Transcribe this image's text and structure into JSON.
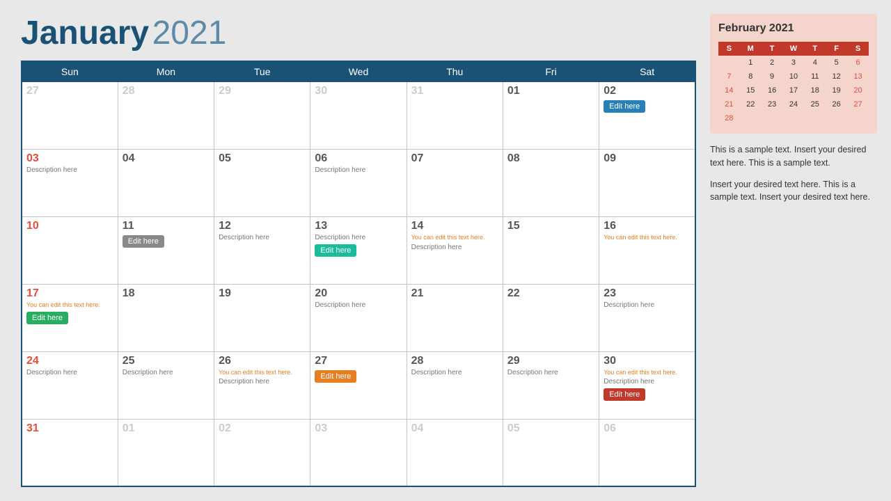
{
  "header": {
    "month": "January",
    "year": "2021"
  },
  "calendar": {
    "days": [
      "Sun",
      "Mon",
      "Tue",
      "Wed",
      "Thu",
      "Fri",
      "Sat"
    ],
    "rows": [
      [
        {
          "num": "27",
          "type": "other-month"
        },
        {
          "num": "28",
          "type": "other-month"
        },
        {
          "num": "29",
          "type": "other-month"
        },
        {
          "num": "30",
          "type": "other-month"
        },
        {
          "num": "31",
          "type": "other-month"
        },
        {
          "num": "01",
          "type": "normal"
        },
        {
          "num": "02",
          "type": "normal",
          "event": {
            "label": "Edit here",
            "color": "btn-teal"
          }
        }
      ],
      [
        {
          "num": "03",
          "type": "sunday",
          "desc": "Description here"
        },
        {
          "num": "04",
          "type": "normal"
        },
        {
          "num": "05",
          "type": "normal"
        },
        {
          "num": "06",
          "type": "normal",
          "desc": "Description here"
        },
        {
          "num": "07",
          "type": "normal"
        },
        {
          "num": "08",
          "type": "normal"
        },
        {
          "num": "09",
          "type": "normal"
        }
      ],
      [
        {
          "num": "10",
          "type": "sunday"
        },
        {
          "num": "11",
          "type": "normal",
          "event": {
            "label": "Edit here",
            "color": "btn-gray"
          }
        },
        {
          "num": "12",
          "type": "normal",
          "desc": "Description here"
        },
        {
          "num": "13",
          "type": "normal",
          "desc": "Description here",
          "event": {
            "label": "Edit here",
            "color": "btn-cyan"
          }
        },
        {
          "num": "14",
          "type": "normal",
          "note": "You can edit this text here.",
          "desc": "Description here"
        },
        {
          "num": "15",
          "type": "normal"
        },
        {
          "num": "16",
          "type": "normal",
          "note": "You can edit this text here."
        }
      ],
      [
        {
          "num": "17",
          "type": "sunday",
          "note": "You can edit this text here.",
          "event": {
            "label": "Edit here",
            "color": "btn-green"
          }
        },
        {
          "num": "18",
          "type": "normal"
        },
        {
          "num": "19",
          "type": "normal"
        },
        {
          "num": "20",
          "type": "normal",
          "desc": "Description here"
        },
        {
          "num": "21",
          "type": "normal"
        },
        {
          "num": "22",
          "type": "normal"
        },
        {
          "num": "23",
          "type": "normal",
          "desc": "Description here"
        }
      ],
      [
        {
          "num": "24",
          "type": "sunday",
          "desc": "Description here"
        },
        {
          "num": "25",
          "type": "normal",
          "desc": "Description here"
        },
        {
          "num": "26",
          "type": "normal",
          "note": "You can edit this text here.",
          "desc": "Description here"
        },
        {
          "num": "27",
          "type": "normal",
          "event": {
            "label": "Edit here",
            "color": "btn-orange"
          }
        },
        {
          "num": "28",
          "type": "normal",
          "desc": "Description here"
        },
        {
          "num": "29",
          "type": "normal",
          "desc": "Description here"
        },
        {
          "num": "30",
          "type": "normal",
          "note": "You can edit this text here.",
          "desc": "Description here",
          "event": {
            "label": "Edit here",
            "color": "btn-red"
          }
        }
      ],
      [
        {
          "num": "31",
          "type": "sunday"
        },
        {
          "num": "01",
          "type": "other-month"
        },
        {
          "num": "02",
          "type": "other-month"
        },
        {
          "num": "03",
          "type": "other-month"
        },
        {
          "num": "04",
          "type": "other-month"
        },
        {
          "num": "05",
          "type": "other-month"
        },
        {
          "num": "06",
          "type": "other-month"
        }
      ]
    ]
  },
  "mini_cal": {
    "title": "February 2021",
    "headers": [
      "S",
      "M",
      "T",
      "W",
      "T",
      "F",
      "S"
    ],
    "rows": [
      [
        "",
        "1",
        "2",
        "3",
        "4",
        "5",
        "6"
      ],
      [
        "7",
        "8",
        "9",
        "10",
        "11",
        "12",
        "13"
      ],
      [
        "14",
        "15",
        "16",
        "17",
        "18",
        "19",
        "20"
      ],
      [
        "21",
        "22",
        "23",
        "24",
        "25",
        "26",
        "27"
      ],
      [
        "28",
        "",
        "",
        "",
        "",
        "",
        ""
      ]
    ]
  },
  "sidebar_texts": [
    "This is a sample text. Insert your desired text here. This is a sample text.",
    "Insert your desired text here. This is a sample text. Insert your desired text here."
  ]
}
